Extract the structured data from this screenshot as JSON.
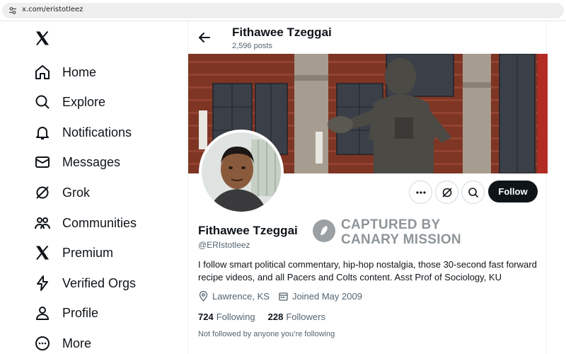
{
  "browser": {
    "url": "x.com/eristotleez"
  },
  "nav": {
    "items": [
      {
        "label": "Home",
        "icon": "home-icon"
      },
      {
        "label": "Explore",
        "icon": "search-icon"
      },
      {
        "label": "Notifications",
        "icon": "bell-icon"
      },
      {
        "label": "Messages",
        "icon": "envelope-icon"
      },
      {
        "label": "Grok",
        "icon": "grok-icon"
      },
      {
        "label": "Communities",
        "icon": "people-icon"
      },
      {
        "label": "Premium",
        "icon": "x-logo-icon"
      },
      {
        "label": "Verified Orgs",
        "icon": "lightning-icon"
      },
      {
        "label": "Profile",
        "icon": "person-icon"
      },
      {
        "label": "More",
        "icon": "more-circle-icon"
      }
    ]
  },
  "header": {
    "name": "Fithawee Tzeggai",
    "posts": "2,596 posts"
  },
  "profile": {
    "name": "Fithawee Tzeggai",
    "handle": "@ERIstotleez",
    "bio": "I follow smart political commentary, hip-hop nostalgia, those 30-second fast forward recipe videos, and all Pacers and Colts content. Asst Prof of Sociology, KU",
    "location": "Lawrence, KS",
    "joined": "Joined May 2009",
    "following_count": "724",
    "following_label": "Following",
    "followers_count": "228",
    "followers_label": "Followers",
    "not_followed": "Not followed by anyone you’re following"
  },
  "actions": {
    "follow_label": "Follow"
  },
  "watermark": {
    "line1": "CAPTURED BY",
    "line2": "CANARY MISSION"
  },
  "colors": {
    "text": "#0f1419",
    "secondary": "#536471",
    "border": "#cfd9de",
    "follow_bg": "#0f1419"
  }
}
